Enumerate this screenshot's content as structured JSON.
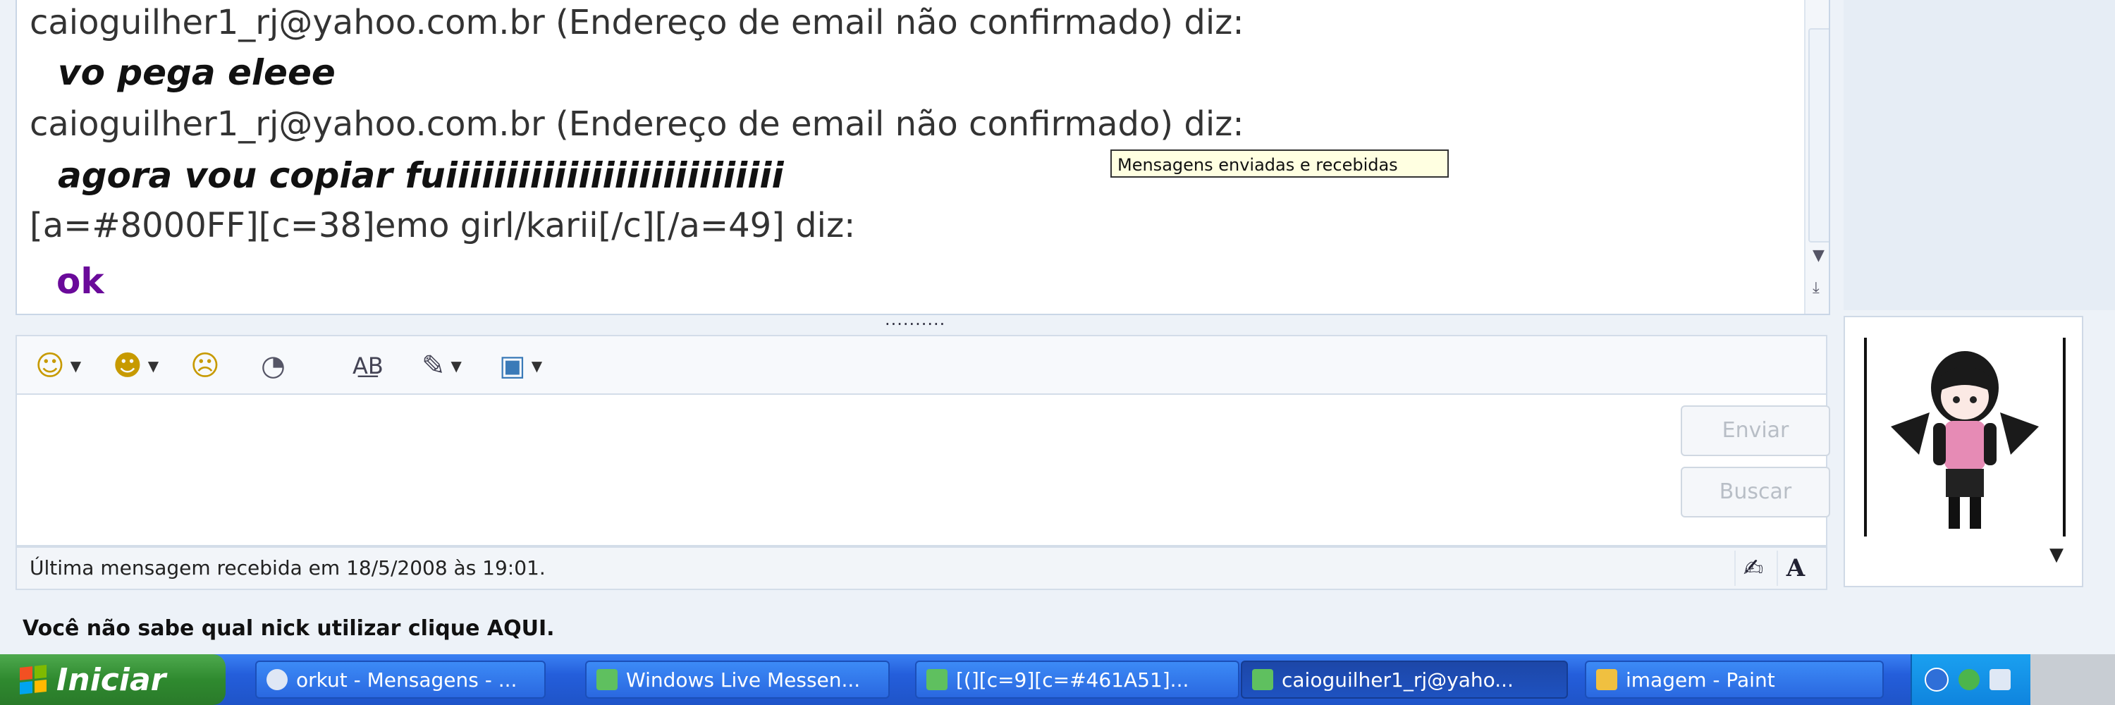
{
  "conversation": {
    "messages": [
      {
        "header": "caioguilher1_rj@yahoo.com.br (Endereço de email não confirmado) diz:",
        "text": "vo pega eleee"
      },
      {
        "header": "caioguilher1_rj@yahoo.com.br (Endereço de email não confirmado) diz:",
        "text": "agora vou copiar fuiiiiiiiiiiiiiiiiiiiiiiiiiiii"
      },
      {
        "header": "[a=#8000FF][c=38]emo girl/karii[/c][/a=49] diz:",
        "text": "ok"
      }
    ],
    "tooltip": "Mensagens enviadas e recebidas"
  },
  "toolbar": {
    "emoticon_icon": "smiley-icon",
    "wink_icon": "wink-icon",
    "nudge_icon": "nudge-icon",
    "voice_icon": "voice-clip-icon",
    "font_icon": "font-icon",
    "background_icon": "background-icon",
    "picture_icon": "picture-icon"
  },
  "input": {
    "send_label": "Enviar",
    "search_label": "Buscar"
  },
  "status": {
    "last_message": "Última mensagem recebida em 18/5/2008 às 19:01.",
    "font_button": "A"
  },
  "nick_link": "Você não sabe qual nick utilizar clique AQUI.",
  "taskbar": {
    "start_label": "Iniciar",
    "tasks": [
      {
        "label": "orkut - Mensagens - ..."
      },
      {
        "label": "Windows Live Messen..."
      },
      {
        "label": "[(][c=9][c=#461A51]..."
      },
      {
        "label": "caioguilher1_rj@yaho..."
      },
      {
        "label": "imagem - Paint"
      }
    ]
  },
  "colors": {
    "message_ok": "#6a0a9a",
    "taskbar_blue": "#245edb",
    "start_green": "#2f8a2f",
    "tooltip_bg": "#ffffe1"
  }
}
